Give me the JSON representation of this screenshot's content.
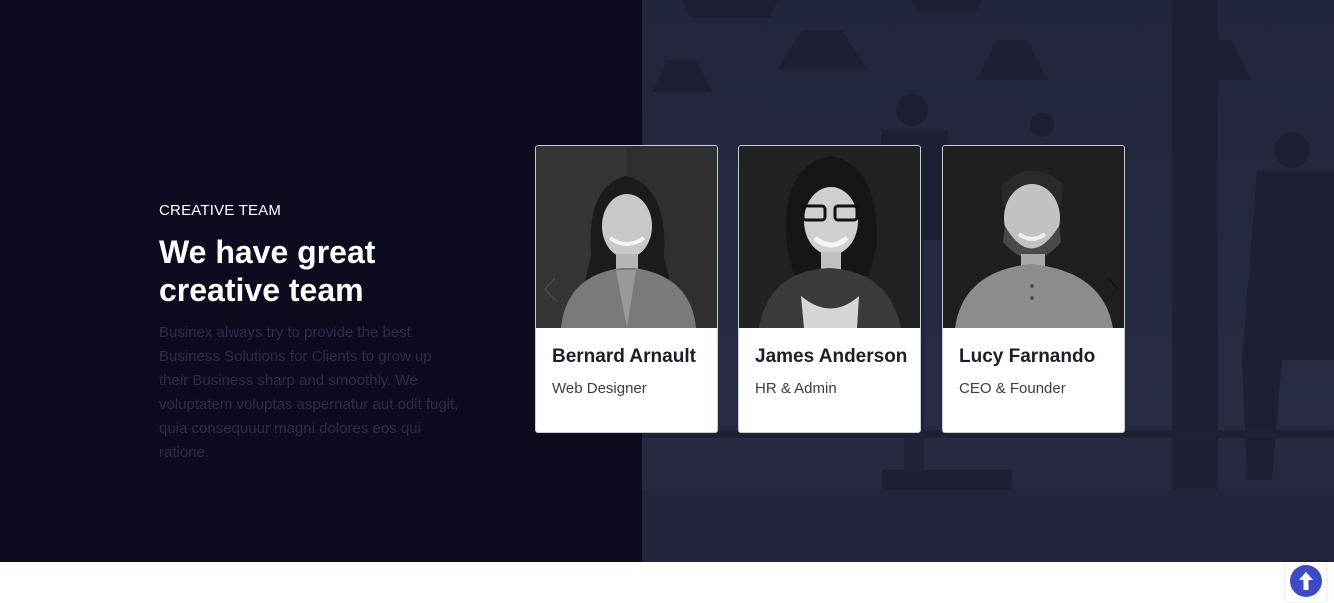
{
  "team_section": {
    "eyebrow": "CREATIVE TEAM",
    "heading_line1": "We have great",
    "heading_line2": "creative team",
    "description": "Businex always try to provide the best Business Solutions for Clients to grow up their Business sharp and smoothly. We voluptatem voluptas aspernatur aut odit fugit, quia consequuur magni dolores eos qui ratione."
  },
  "team_members": [
    {
      "name": "Bernard Arnault",
      "role": "Web Designer",
      "photo_icon": "woman-portrait"
    },
    {
      "name": "James Anderson",
      "role": "HR & Admin",
      "photo_icon": "woman-glasses-portrait"
    },
    {
      "name": "Lucy Farnando",
      "role": "CEO & Founder",
      "photo_icon": "bearded-man-portrait"
    }
  ],
  "carousel": {
    "prev_icon": "chevron-left-icon",
    "next_icon": "chevron-right-icon"
  },
  "scroll_top": {
    "icon": "arrow-up-icon"
  },
  "colors": {
    "section_bg": "#0b0d1e",
    "accent": "#3f4bc4",
    "card_bg": "#ffffff"
  }
}
